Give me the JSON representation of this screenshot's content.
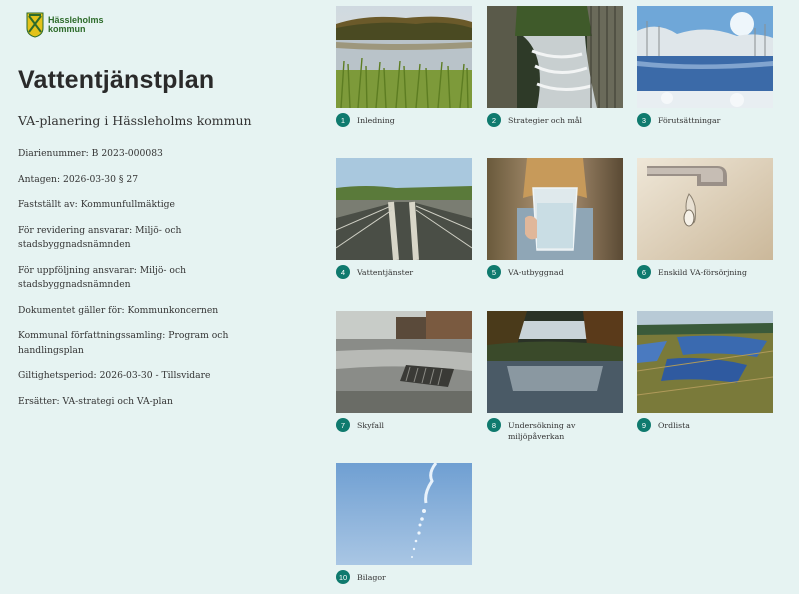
{
  "logo": {
    "line1": "Hässleholms",
    "line2": "kommun"
  },
  "title": "Vattentjänstplan",
  "subtitle": "VA-planering i Hässleholms kommun",
  "meta": [
    "Diarienummer: B 2023-000083",
    "Antagen: 2026-03-30  § 27",
    "Fastställt av: Kommunfullmäktige",
    "För revidering ansvarar: Miljö- och stadsbyggnadsnämnden",
    "För uppföljning ansvarar: Miljö- och stadsbyggnadsnämnden",
    "Dokumentet gäller för: Kommunkoncernen",
    "Kommunal författningssamling: Program och handlingsplan",
    "Giltighetsperiod: 2026-03-30 - Tillsvidare",
    "Ersätter: VA-strategi och VA-plan"
  ],
  "chapters": [
    {
      "num": "1",
      "label": "Inledning",
      "image": "lake-reeds-photo"
    },
    {
      "num": "2",
      "label": "Strategier och mål",
      "image": "stream-photo"
    },
    {
      "num": "3",
      "label": "Förutsättningar",
      "image": "winter-lake-photo"
    },
    {
      "num": "4",
      "label": "Vattentjänster",
      "image": "treatment-plant-photo"
    },
    {
      "num": "5",
      "label": "VA-utbyggnad",
      "image": "water-glass-photo"
    },
    {
      "num": "6",
      "label": "Enskild VA-försörjning",
      "image": "faucet-photo"
    },
    {
      "num": "7",
      "label": "Skyfall",
      "image": "rainy-street-photo"
    },
    {
      "num": "8",
      "label": "Undersökning av miljöpåverkan",
      "image": "forest-lake-photo"
    },
    {
      "num": "9",
      "label": "Ordlista",
      "image": "flooded-field-photo"
    },
    {
      "num": "10",
      "label": "Bilagor",
      "image": "water-splash-photo"
    }
  ]
}
